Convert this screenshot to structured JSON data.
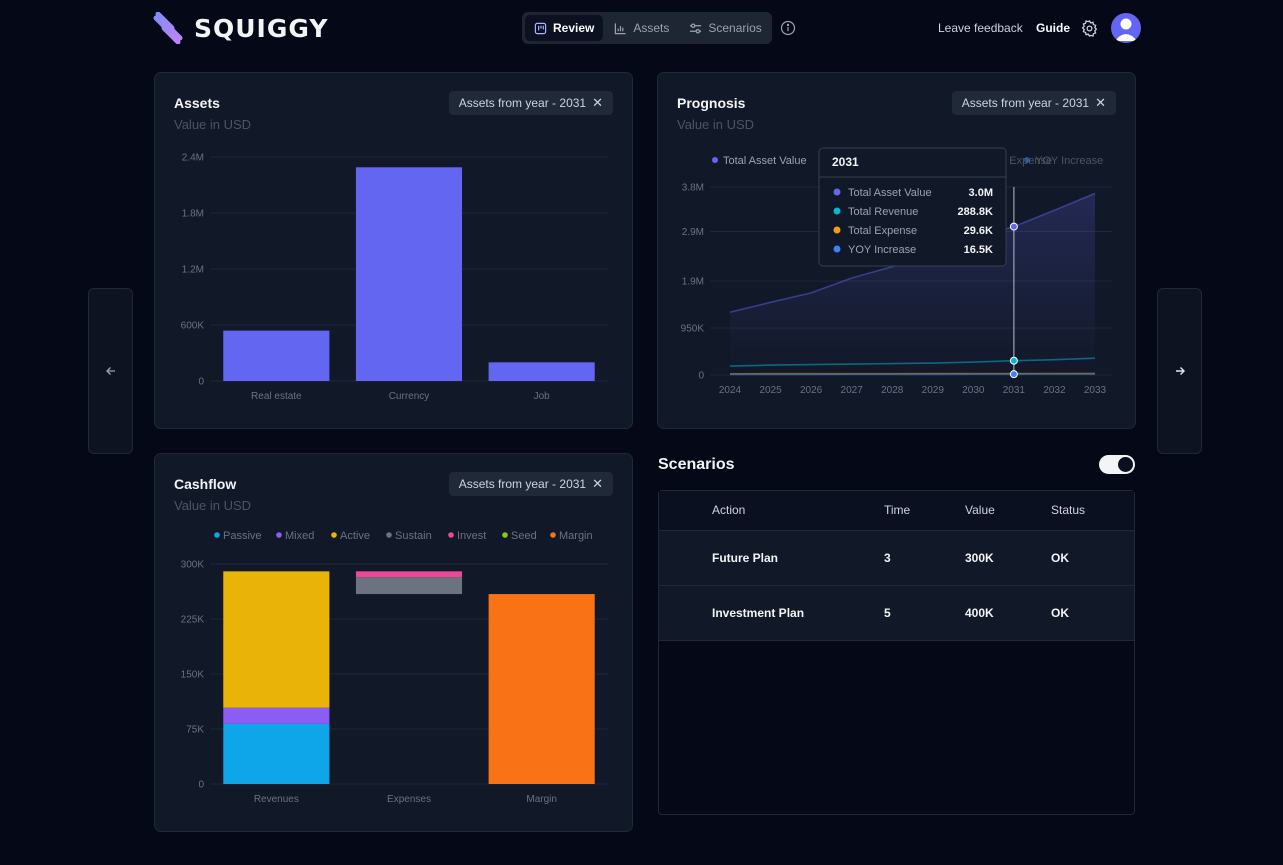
{
  "app": {
    "name": "SQUIGGY",
    "colors": {
      "background": "#040817",
      "card": "#111827",
      "accent": "#6366f1"
    }
  },
  "header": {
    "tabs": [
      {
        "label": "Review",
        "icon": "kanban-icon",
        "active": true
      },
      {
        "label": "Assets",
        "icon": "chart-icon",
        "active": false
      },
      {
        "label": "Scenarios",
        "icon": "sliders-icon",
        "active": false
      }
    ],
    "feedback_label": "Leave feedback",
    "guide_label": "Guide"
  },
  "cards": {
    "assets": {
      "title": "Assets",
      "subtitle": "Value in USD",
      "filter": "Assets from year - 2031"
    },
    "prognosis": {
      "title": "Prognosis",
      "subtitle": "Value in USD",
      "filter": "Assets from year - 2031"
    },
    "cashflow": {
      "title": "Cashflow",
      "subtitle": "Value in USD",
      "filter": "Assets from year - 2031"
    }
  },
  "scenarios": {
    "title": "Scenarios",
    "toggle_on": true,
    "columns": [
      "Action",
      "Time",
      "Value",
      "Status"
    ],
    "rows": [
      {
        "action": "Future Plan",
        "time": "3",
        "value": "300K",
        "status": "OK"
      },
      {
        "action": "Investment Plan",
        "time": "5",
        "value": "400K",
        "status": "OK"
      }
    ]
  },
  "chart_data": [
    {
      "id": "assets",
      "type": "bar",
      "categories": [
        "Real estate",
        "Currency",
        "Job"
      ],
      "values": [
        540000,
        2290000,
        200000
      ],
      "yticks": [
        0,
        600000,
        1200000,
        1800000,
        2400000
      ],
      "ytick_labels": [
        "0",
        "600K",
        "1.2M",
        "1.8M",
        "2.4M"
      ],
      "ylim": [
        0,
        2400000
      ],
      "color": "#6366f1",
      "grid": true
    },
    {
      "id": "prognosis",
      "type": "area",
      "x": [
        2024,
        2025,
        2026,
        2027,
        2028,
        2029,
        2030,
        2031,
        2032,
        2033
      ],
      "series": [
        {
          "name": "Total Asset Value",
          "color": "#6366f1",
          "values": [
            1270000,
            1470000,
            1660000,
            1960000,
            2190000,
            2480000,
            2780000,
            3000000,
            3330000,
            3670000
          ]
        },
        {
          "name": "Total Revenue",
          "color": "#06b6d4",
          "values": [
            180000,
            200000,
            210000,
            220000,
            230000,
            240000,
            260000,
            288800,
            310000,
            340000
          ]
        },
        {
          "name": "Total Expense",
          "color": "#f59e0b",
          "values": [
            25000,
            25500,
            26000,
            26500,
            27000,
            27500,
            28500,
            29600,
            30500,
            31500
          ]
        },
        {
          "name": "YOY Increase",
          "color": "#3b82f6",
          "values": [
            12000,
            12500,
            13000,
            13500,
            14000,
            14500,
            15500,
            16500,
            17500,
            18500
          ]
        }
      ],
      "yticks": [
        0,
        950000,
        1900000,
        2900000,
        3800000
      ],
      "ytick_labels": [
        "0",
        "950K",
        "1.9M",
        "2.9M",
        "3.8M"
      ],
      "ylim": [
        0,
        3800000
      ],
      "legend_position": "top",
      "tooltip": {
        "title": "2031",
        "rows": [
          {
            "label": "Total Asset Value",
            "value": "3.0M",
            "color": "#6366f1"
          },
          {
            "label": "Total Revenue",
            "value": "288.8K",
            "color": "#06b6d4"
          },
          {
            "label": "Total Expense",
            "value": "29.6K",
            "color": "#f59e0b"
          },
          {
            "label": "YOY Increase",
            "value": "16.5K",
            "color": "#3b82f6"
          }
        ]
      }
    },
    {
      "id": "cashflow",
      "type": "bar",
      "stacked": true,
      "categories": [
        "Revenues",
        "Expenses",
        "Margin"
      ],
      "series": [
        {
          "name": "Passive",
          "color": "#0ea5e9",
          "values": [
            82000,
            0,
            0
          ]
        },
        {
          "name": "Mixed",
          "color": "#8b5cf6",
          "values": [
            22000,
            0,
            0
          ]
        },
        {
          "name": "Active",
          "color": "#eab308",
          "values": [
            186000,
            0,
            0
          ]
        },
        {
          "name": "Sustain",
          "color": "#6b7280",
          "values": [
            0,
            23000,
            0
          ]
        },
        {
          "name": "Invest",
          "color": "#ec4899",
          "values": [
            0,
            8000,
            0
          ]
        },
        {
          "name": "Seed",
          "color": "#84cc16",
          "values": [
            0,
            0,
            0
          ]
        },
        {
          "name": "Margin",
          "color": "#f97316",
          "values": [
            0,
            0,
            259000
          ]
        }
      ],
      "expense_base": 259000,
      "yticks": [
        0,
        75000,
        150000,
        225000,
        300000
      ],
      "ytick_labels": [
        "0",
        "75K",
        "150K",
        "225K",
        "300K"
      ],
      "ylim": [
        0,
        300000
      ],
      "legend_position": "top"
    }
  ]
}
